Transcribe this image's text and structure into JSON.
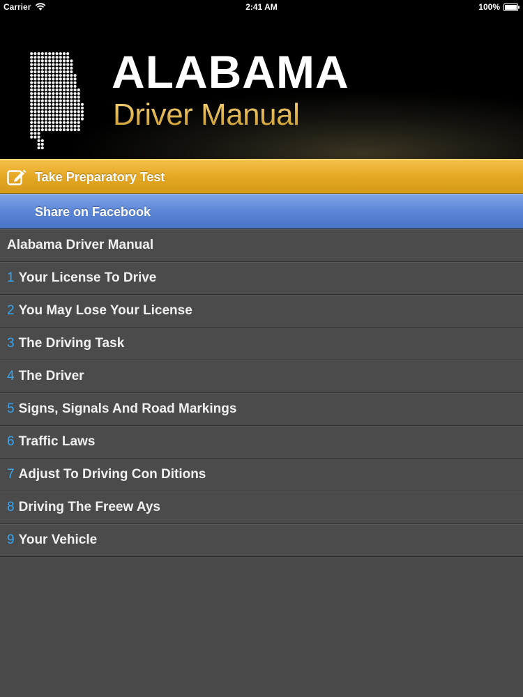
{
  "status_bar": {
    "carrier": "Carrier",
    "time": "2:41 AM",
    "battery": "100%"
  },
  "header": {
    "title": "ALABAMA",
    "subtitle": "Driver Manual",
    "logo_icon": "alabama-map-icon"
  },
  "actions": {
    "prep_test_label": "Take Preparatory Test",
    "share_label": "Share on Facebook",
    "prep_icon": "edit-icon"
  },
  "list": {
    "heading": "Alabama Driver Manual",
    "chapters": [
      {
        "number": "1",
        "title": "Your License To Drive"
      },
      {
        "number": "2",
        "title": "You May Lose Your License"
      },
      {
        "number": "3",
        "title": "The Driving Task"
      },
      {
        "number": "4",
        "title": "The Driver"
      },
      {
        "number": "5",
        "title": "Signs, Signals And Road Markings"
      },
      {
        "number": "6",
        "title": "Traffic Laws"
      },
      {
        "number": "7",
        "title": "Adjust To Driving Con Ditions"
      },
      {
        "number": "8",
        "title": "Driving The Freew Ays"
      },
      {
        "number": "9",
        "title": "Your Vehicle"
      }
    ]
  },
  "colors": {
    "prep_bar": "#e5a824",
    "facebook_bar": "#5c86d6",
    "list_background": "#4a4a4a",
    "chapter_number": "#3aa6ef",
    "subtitle_gold": "#e9c25a"
  }
}
